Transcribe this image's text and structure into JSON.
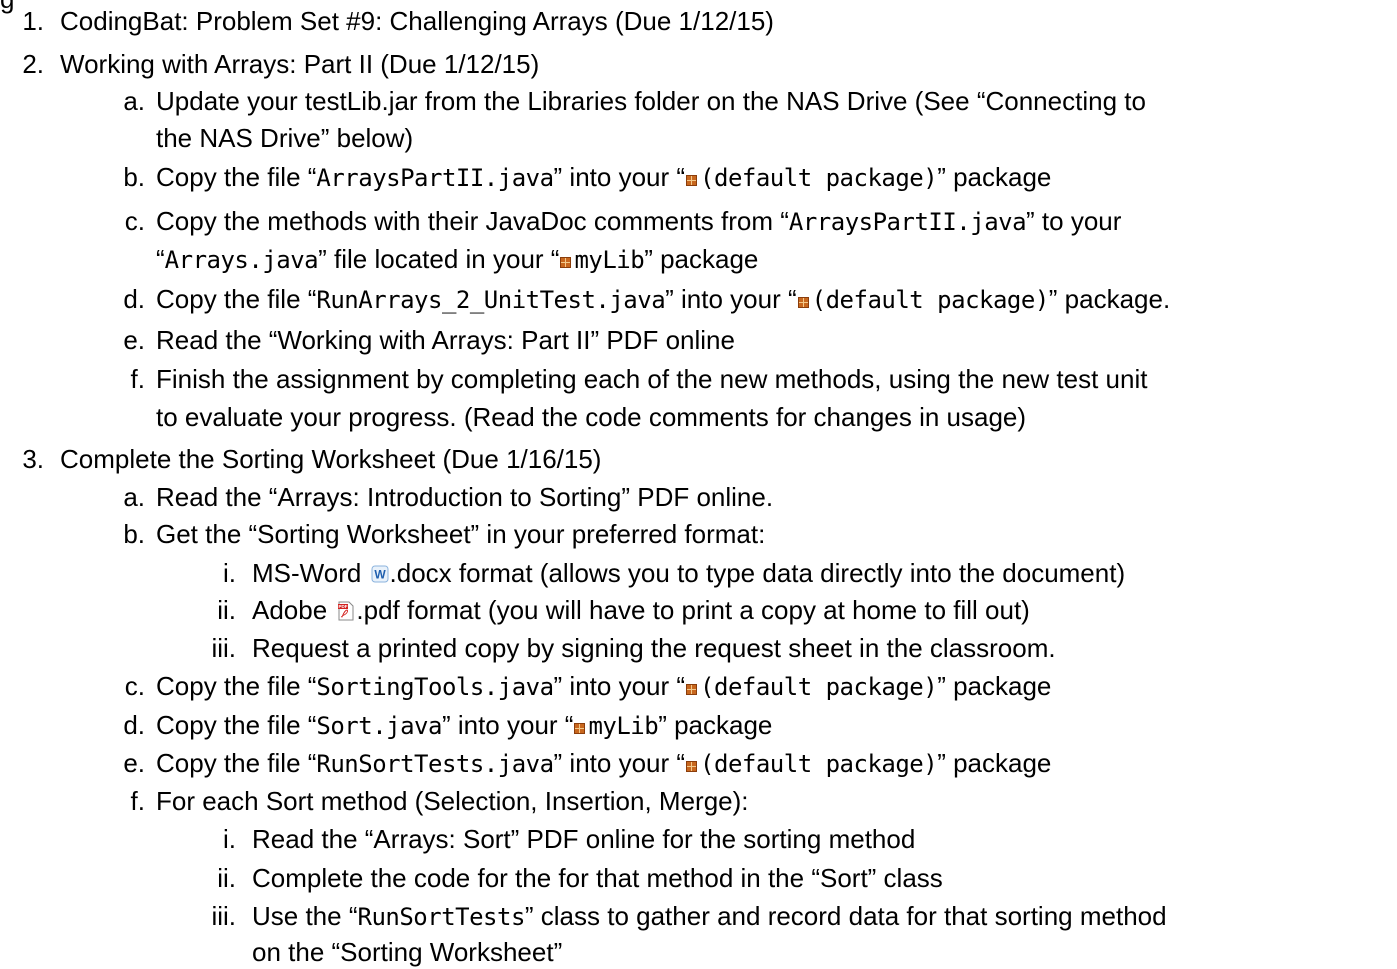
{
  "top_fragment": "g",
  "items": [
    {
      "marker": "1.",
      "parts": [
        {
          "t": "text",
          "v": "CodingBat: Problem Set #9: Challenging Arrays (Due 1/12/15)"
        }
      ]
    },
    {
      "marker": "2.",
      "parts": [
        {
          "t": "text",
          "v": "Working with Arrays: Part II (Due 1/12/15)"
        }
      ]
    },
    {
      "marker": "a.",
      "parts": [
        {
          "t": "text",
          "v": "Update your testLib.jar from the Libraries folder on the NAS Drive (See “Connecting to"
        }
      ]
    },
    {
      "marker": "",
      "parts": [
        {
          "t": "text",
          "v": "the NAS Drive” below)"
        }
      ]
    },
    {
      "marker": "b.",
      "parts": [
        {
          "t": "text",
          "v": "Copy the file “"
        },
        {
          "t": "mono",
          "v": "ArraysPartII.java"
        },
        {
          "t": "text",
          "v": "” into your “"
        },
        {
          "t": "icon",
          "v": "package-icon"
        },
        {
          "t": "mono",
          "v": "(default package)"
        },
        {
          "t": "text",
          "v": "” package"
        }
      ]
    },
    {
      "marker": "c.",
      "parts": [
        {
          "t": "text",
          "v": "Copy the methods with their JavaDoc comments from “"
        },
        {
          "t": "mono",
          "v": "ArraysPartII.java"
        },
        {
          "t": "text",
          "v": "” to your"
        }
      ]
    },
    {
      "marker": "",
      "parts": [
        {
          "t": "text",
          "v": "“"
        },
        {
          "t": "mono",
          "v": "Arrays.java"
        },
        {
          "t": "text",
          "v": "” file located in your “"
        },
        {
          "t": "icon",
          "v": "package-icon"
        },
        {
          "t": "mono",
          "v": "myLib"
        },
        {
          "t": "text",
          "v": "” package"
        }
      ]
    },
    {
      "marker": "d.",
      "parts": [
        {
          "t": "text",
          "v": "Copy the file “"
        },
        {
          "t": "mono",
          "v": "RunArrays_2_UnitTest.java"
        },
        {
          "t": "text",
          "v": "” into your “"
        },
        {
          "t": "icon",
          "v": "package-icon"
        },
        {
          "t": "mono",
          "v": "(default package)"
        },
        {
          "t": "text",
          "v": "” package."
        }
      ]
    },
    {
      "marker": "e.",
      "parts": [
        {
          "t": "text",
          "v": "Read the “Working with Arrays: Part II” PDF online"
        }
      ]
    },
    {
      "marker": "f.",
      "parts": [
        {
          "t": "text",
          "v": "Finish the assignment by completing each of the new methods, using the new test unit"
        }
      ]
    },
    {
      "marker": "",
      "parts": [
        {
          "t": "text",
          "v": "to evaluate your progress. (Read the code comments for changes in usage)"
        }
      ]
    },
    {
      "marker": "3.",
      "parts": [
        {
          "t": "text",
          "v": "Complete the Sorting Worksheet (Due 1/16/15)"
        }
      ]
    },
    {
      "marker": "a.",
      "parts": [
        {
          "t": "text",
          "v": "Read the “Arrays: Introduction to Sorting” PDF online."
        }
      ]
    },
    {
      "marker": "b.",
      "parts": [
        {
          "t": "text",
          "v": "Get the “Sorting Worksheet” in your preferred format:"
        }
      ]
    },
    {
      "marker": "i.",
      "parts": [
        {
          "t": "text",
          "v": "MS-Word "
        },
        {
          "t": "icon",
          "v": "word-doc-icon"
        },
        {
          "t": "text",
          "v": ".docx format (allows you to type data directly into the document)"
        }
      ]
    },
    {
      "marker": "ii.",
      "parts": [
        {
          "t": "text",
          "v": "Adobe "
        },
        {
          "t": "icon",
          "v": "pdf-icon"
        },
        {
          "t": "text",
          "v": ".pdf format (you will have to print a copy at home to fill out)"
        }
      ]
    },
    {
      "marker": "iii.",
      "parts": [
        {
          "t": "text",
          "v": "Request a printed copy by signing the request sheet in the classroom."
        }
      ]
    },
    {
      "marker": "c.",
      "parts": [
        {
          "t": "text",
          "v": "Copy the file “"
        },
        {
          "t": "mono",
          "v": "SortingTools.java"
        },
        {
          "t": "text",
          "v": "” into your “"
        },
        {
          "t": "icon",
          "v": "package-icon"
        },
        {
          "t": "mono",
          "v": "(default package)"
        },
        {
          "t": "text",
          "v": "” package"
        }
      ]
    },
    {
      "marker": "d.",
      "parts": [
        {
          "t": "text",
          "v": "Copy the file “"
        },
        {
          "t": "mono",
          "v": "Sort.java"
        },
        {
          "t": "text",
          "v": "” into your “"
        },
        {
          "t": "icon",
          "v": "package-icon"
        },
        {
          "t": "mono",
          "v": "myLib"
        },
        {
          "t": "text",
          "v": "” package"
        }
      ]
    },
    {
      "marker": "e.",
      "parts": [
        {
          "t": "text",
          "v": "Copy the file “"
        },
        {
          "t": "mono",
          "v": "RunSortTests.java"
        },
        {
          "t": "text",
          "v": "” into your “"
        },
        {
          "t": "icon",
          "v": "package-icon"
        },
        {
          "t": "mono",
          "v": "(default package)"
        },
        {
          "t": "text",
          "v": "” package"
        }
      ]
    },
    {
      "marker": "f.",
      "parts": [
        {
          "t": "text",
          "v": "For each Sort method (Selection, Insertion, Merge):"
        }
      ]
    },
    {
      "marker": "i.",
      "parts": [
        {
          "t": "text",
          "v": "Read the “Arrays: Sort” PDF online for the sorting method"
        }
      ]
    },
    {
      "marker": "ii.",
      "parts": [
        {
          "t": "text",
          "v": "Complete the code for the for that method in the “Sort” class"
        }
      ]
    },
    {
      "marker": "iii.",
      "parts": [
        {
          "t": "text",
          "v": "Use the “"
        },
        {
          "t": "mono",
          "v": "RunSortTests"
        },
        {
          "t": "text",
          "v": "” class to gather and record data for that sorting method"
        }
      ]
    },
    {
      "marker": "",
      "parts": [
        {
          "t": "text",
          "v": "on the “Sorting Worksheet”"
        }
      ]
    }
  ]
}
